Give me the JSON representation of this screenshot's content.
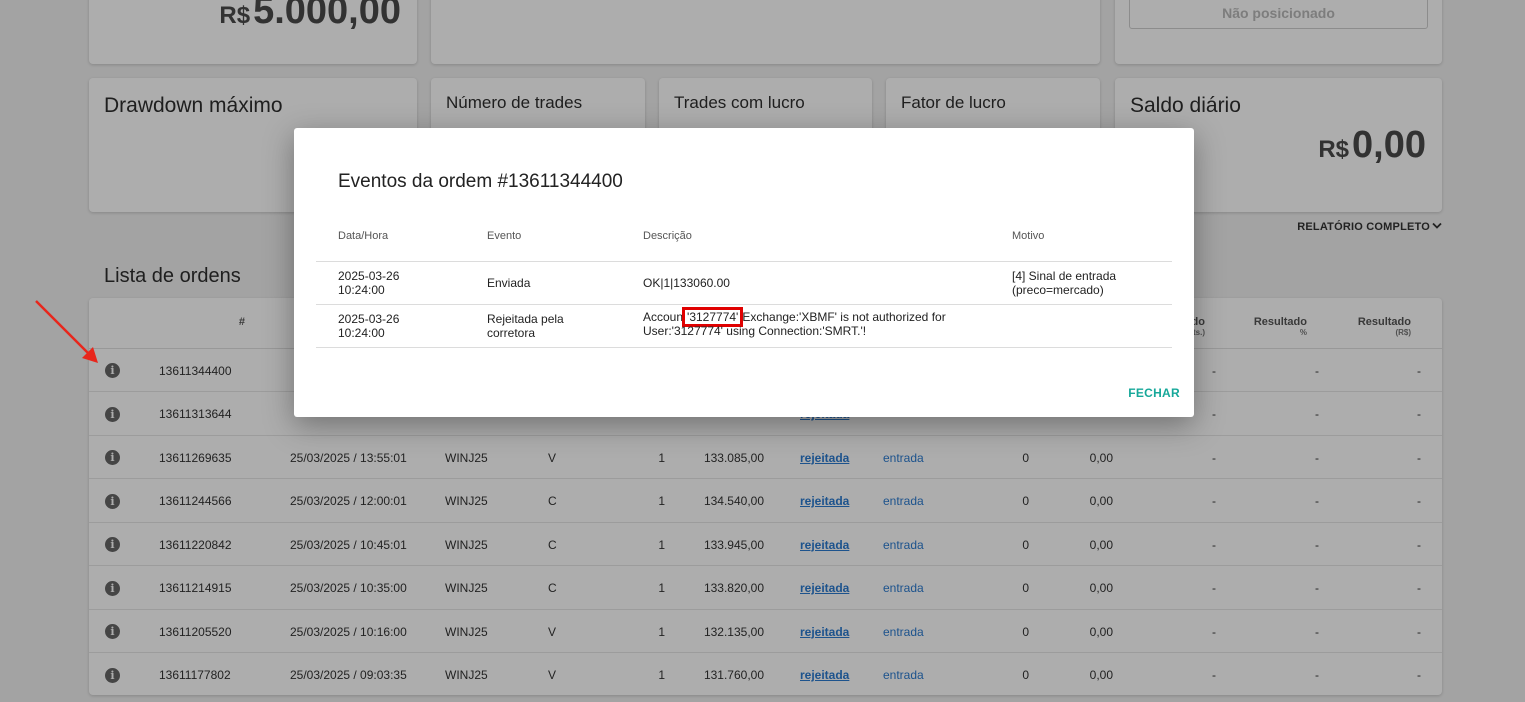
{
  "top_cards": {
    "initial_value": {
      "currency": "R$",
      "value": "5.000,00"
    },
    "position": {
      "button_label": "Não posicionado"
    }
  },
  "stat_cards": {
    "drawdown": {
      "title": "Drawdown máximo"
    },
    "num_trades": {
      "title": "Número de trades"
    },
    "profit_trades": {
      "title": "Trades com lucro"
    },
    "profit_factor": {
      "title": "Fator de lucro"
    },
    "daily_balance": {
      "title": "Saldo diário",
      "currency": "R$",
      "value": "0,00"
    }
  },
  "report_link": "RELATÓRIO COMPLETO",
  "orders": {
    "title": "Lista de ordens",
    "headers": {
      "number": "#",
      "result_points": "Resultado",
      "result_points_unit": "(pts.)",
      "result_pct": "Resultado",
      "result_pct_unit": "%",
      "result_brl": "Resultado",
      "result_brl_unit": "(R$)"
    },
    "rows": [
      {
        "id": "13611344400",
        "date": "",
        "asset": "",
        "side": "",
        "qty": "",
        "price": "",
        "status": "",
        "type": "",
        "filled": "",
        "avg": "",
        "res_pts": "-",
        "res_pct": "-",
        "res_brl": "-"
      },
      {
        "id": "13611313644",
        "date": "",
        "asset": "",
        "side": "",
        "qty": "",
        "price": "",
        "status": "rejeitada",
        "type": "",
        "filled": "",
        "avg": "",
        "res_pts": "-",
        "res_pct": "-",
        "res_brl": "-"
      },
      {
        "id": "13611269635",
        "date": "25/03/2025 / 13:55:01",
        "asset": "WINJ25",
        "side": "V",
        "qty": "1",
        "price": "133.085,00",
        "status": "rejeitada",
        "type": "entrada",
        "filled": "0",
        "avg": "0,00",
        "res_pts": "-",
        "res_pct": "-",
        "res_brl": "-"
      },
      {
        "id": "13611244566",
        "date": "25/03/2025 / 12:00:01",
        "asset": "WINJ25",
        "side": "C",
        "qty": "1",
        "price": "134.540,00",
        "status": "rejeitada",
        "type": "entrada",
        "filled": "0",
        "avg": "0,00",
        "res_pts": "-",
        "res_pct": "-",
        "res_brl": "-"
      },
      {
        "id": "13611220842",
        "date": "25/03/2025 / 10:45:01",
        "asset": "WINJ25",
        "side": "C",
        "qty": "1",
        "price": "133.945,00",
        "status": "rejeitada",
        "type": "entrada",
        "filled": "0",
        "avg": "0,00",
        "res_pts": "-",
        "res_pct": "-",
        "res_brl": "-"
      },
      {
        "id": "13611214915",
        "date": "25/03/2025 / 10:35:00",
        "asset": "WINJ25",
        "side": "C",
        "qty": "1",
        "price": "133.820,00",
        "status": "rejeitada",
        "type": "entrada",
        "filled": "0",
        "avg": "0,00",
        "res_pts": "-",
        "res_pct": "-",
        "res_brl": "-"
      },
      {
        "id": "13611205520",
        "date": "25/03/2025 / 10:16:00",
        "asset": "WINJ25",
        "side": "V",
        "qty": "1",
        "price": "132.135,00",
        "status": "rejeitada",
        "type": "entrada",
        "filled": "0",
        "avg": "0,00",
        "res_pts": "-",
        "res_pct": "-",
        "res_brl": "-"
      },
      {
        "id": "13611177802",
        "date": "25/03/2025 / 09:03:35",
        "asset": "WINJ25",
        "side": "V",
        "qty": "1",
        "price": "131.760,00",
        "status": "rejeitada",
        "type": "entrada",
        "filled": "0",
        "avg": "0,00",
        "res_pts": "-",
        "res_pct": "-",
        "res_brl": "-"
      }
    ]
  },
  "modal": {
    "title": "Eventos da ordem #13611344400",
    "headers": {
      "datetime": "Data/Hora",
      "event": "Evento",
      "description": "Descrição",
      "reason": "Motivo"
    },
    "events": [
      {
        "date": "2025-03-26",
        "time": "10:24:00",
        "event_line1": "Enviada",
        "event_line2": "",
        "desc_pre": "OK|1|133060.00",
        "desc_hl": "",
        "desc_post": "",
        "desc_line2": "",
        "reason_line1": "[4] Sinal de entrada",
        "reason_line2": "(preco=mercado)"
      },
      {
        "date": "2025-03-26",
        "time": "10:24:00",
        "event_line1": "Rejeitada pela",
        "event_line2": "corretora",
        "desc_pre": "Accoun",
        "desc_hl": "'3127774'",
        "desc_post": "Exchange:'XBMF' is not authorized for",
        "desc_line2": "User:'3127774' using Connection:'SMRT.'!",
        "reason_line1": "",
        "reason_line2": ""
      }
    ],
    "close_label": "FECHAR"
  },
  "colors": {
    "accent": "#17a89a",
    "link": "#2b7bd0",
    "highlight": "#e00000",
    "arrow": "#e8261c"
  }
}
